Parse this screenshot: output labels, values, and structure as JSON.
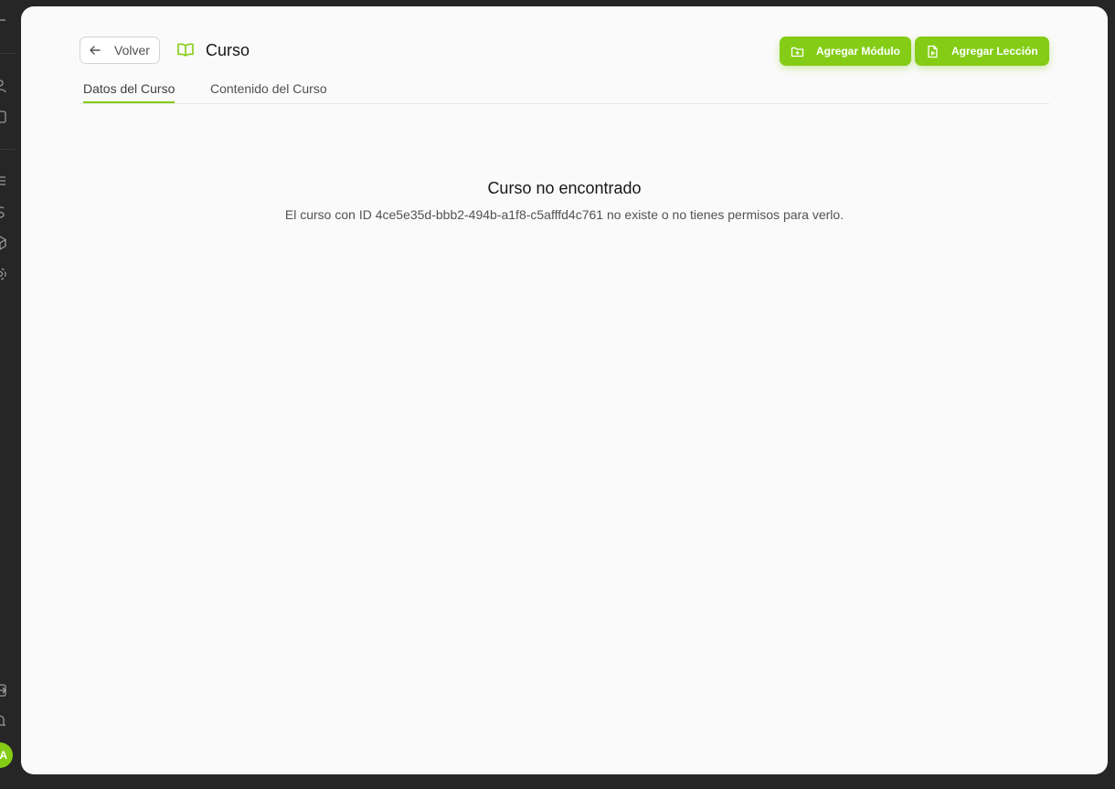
{
  "header": {
    "back_label": "Volver",
    "title": "Curso",
    "add_module_label": "Agregar Módulo",
    "add_lesson_label": "Agregar Lección"
  },
  "tabs": [
    {
      "label": "Datos del Curso",
      "active": true
    },
    {
      "label": "Contenido del Curso",
      "active": false
    }
  ],
  "empty_state": {
    "title": "Curso no encontrado",
    "message": "El curso con ID 4ce5e35d-bbb2-494b-a1f8-c5afffd4c761 no existe o no tienes permisos para verlo."
  },
  "sidebar": {
    "avatar_initial": "A",
    "icons": [
      "users-icon",
      "square-icon",
      "list-icon",
      "dollar-icon",
      "cube-icon",
      "settings-icon",
      "export-icon",
      "bell-icon"
    ]
  },
  "colors": {
    "accent": "#84cc16",
    "background": "#262626",
    "card": "#fafafa"
  }
}
